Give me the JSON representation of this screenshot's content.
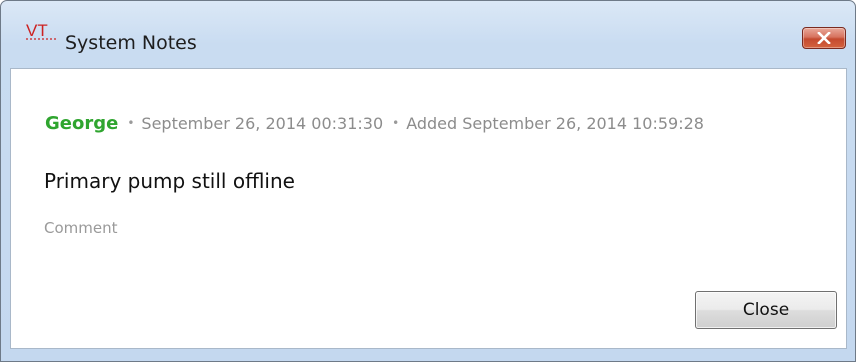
{
  "window": {
    "title": "System Notes",
    "logo_text": "VT",
    "close_icon": "close-x-icon",
    "colors": {
      "logo": "#cc2222",
      "close_button": "#c94d33",
      "author": "#2fa52f",
      "meta": "#8c8c8c"
    }
  },
  "note": {
    "author": "George",
    "separator": "•",
    "timestamp": "September 26, 2014 00:31:30",
    "added": "Added September 26, 2014 10:59:28",
    "text": "Primary pump still offline",
    "comment_label": "Comment"
  },
  "buttons": {
    "close_label": "Close"
  }
}
